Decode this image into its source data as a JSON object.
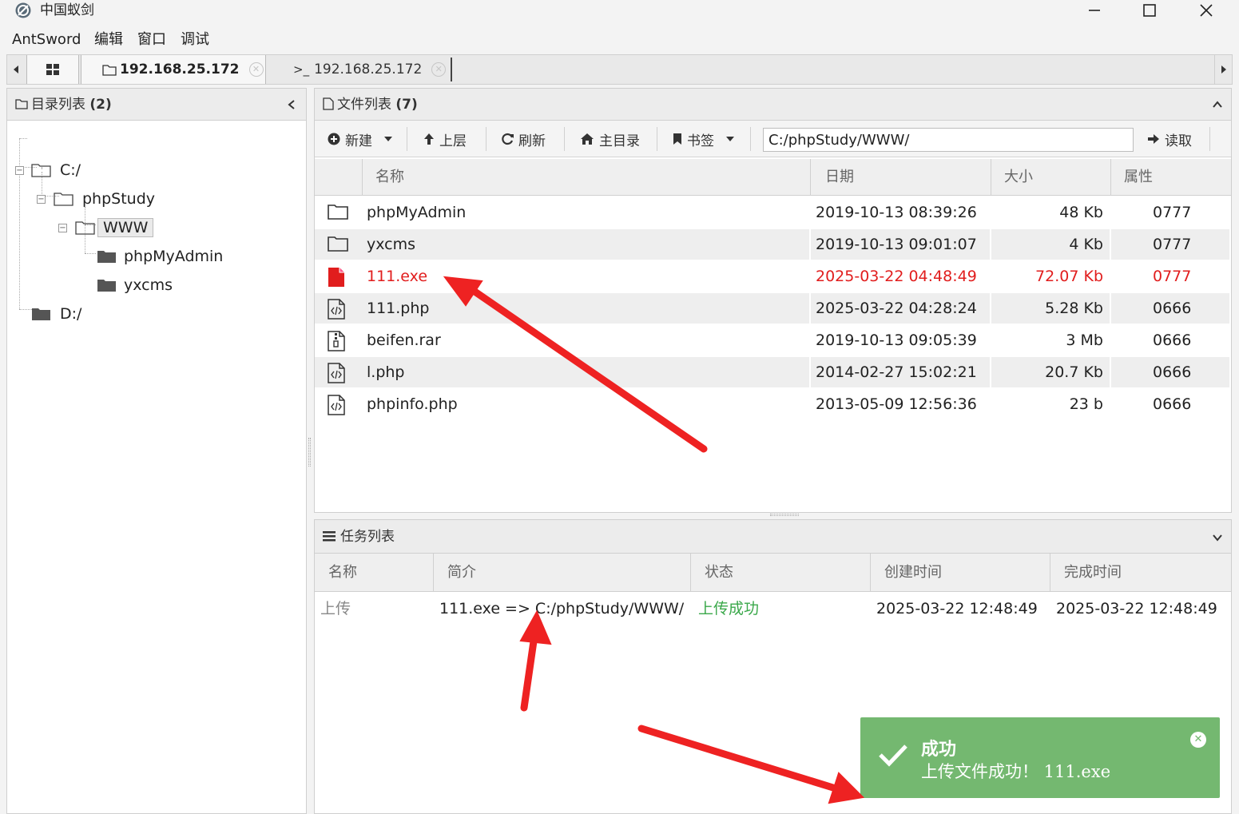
{
  "window": {
    "title": "中国蚁剑",
    "menu": [
      "AntSword",
      "编辑",
      "窗口",
      "调试"
    ]
  },
  "tabs": [
    {
      "label": "192.168.25.172",
      "type": "folder",
      "active": true
    },
    {
      "label": "192.168.25.172",
      "type": "terminal",
      "active": false
    }
  ],
  "dir_panel": {
    "title": "目录列表",
    "count": "(2)",
    "tree": [
      {
        "label": "C:/"
      },
      {
        "label": "phpStudy"
      },
      {
        "label": "WWW"
      },
      {
        "label": "phpMyAdmin"
      },
      {
        "label": "yxcms"
      },
      {
        "label": "D:/"
      }
    ]
  },
  "file_panel": {
    "title": "文件列表",
    "count": "(7)",
    "toolbar": {
      "new": "新建",
      "up": "上层",
      "refresh": "刷新",
      "home": "主目录",
      "bookmark": "书签",
      "read": "读取"
    },
    "path": "C:/phpStudy/WWW/",
    "columns": [
      "名称",
      "日期",
      "大小",
      "属性"
    ],
    "files": [
      {
        "name": "phpMyAdmin",
        "date": "2019-10-13 08:39:26",
        "size": "48 Kb",
        "perm": "0777",
        "icon": "folder-icon"
      },
      {
        "name": "yxcms",
        "date": "2019-10-13 09:01:07",
        "size": "4 Kb",
        "perm": "0777",
        "icon": "folder-icon"
      },
      {
        "name": "111.exe",
        "date": "2025-03-22 04:48:49",
        "size": "72.07 Kb",
        "perm": "0777",
        "icon": "file-icon",
        "highlight": true
      },
      {
        "name": "111.php",
        "date": "2025-03-22 04:28:24",
        "size": "5.28 Kb",
        "perm": "0666",
        "icon": "code-file-icon"
      },
      {
        "name": "beifen.rar",
        "date": "2019-10-13 09:05:39",
        "size": "3 Mb",
        "perm": "0666",
        "icon": "archive-file-icon"
      },
      {
        "name": "l.php",
        "date": "2014-02-27 15:02:21",
        "size": "20.7 Kb",
        "perm": "0666",
        "icon": "code-file-icon"
      },
      {
        "name": "phpinfo.php",
        "date": "2013-05-09 12:56:36",
        "size": "23 b",
        "perm": "0666",
        "icon": "code-file-icon"
      }
    ]
  },
  "task_panel": {
    "title": "任务列表",
    "columns": [
      "名称",
      "简介",
      "状态",
      "创建时间",
      "完成时间"
    ],
    "tasks": [
      {
        "name": "上传",
        "desc": "111.exe => C:/phpStudy/WWW/",
        "status": "上传成功",
        "created": "2025-03-22 12:48:49",
        "finished": "2025-03-22 12:48:49"
      }
    ]
  },
  "toast": {
    "title": "成功",
    "message": "上传文件成功！ 111.exe"
  },
  "colors": {
    "highlight_red": "#e11d1d",
    "success_green": "#74b870",
    "status_green": "#3aa84a",
    "annotation_arrow": "#ee2222"
  }
}
